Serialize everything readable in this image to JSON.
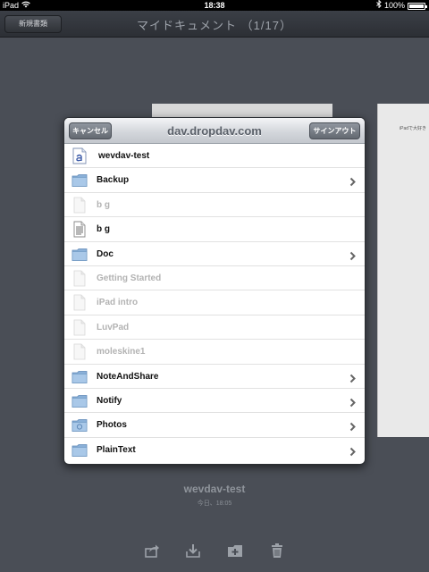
{
  "status_bar": {
    "carrier": "iPad",
    "time": "18:38",
    "battery": "100%"
  },
  "nav": {
    "new_document_label": "新規書類",
    "title": "マイドキュメント （1/17）"
  },
  "background_doc": {
    "preview_text": "iPadで大好き"
  },
  "popover": {
    "cancel_label": "キャンセル",
    "title": "dav.dropdav.com",
    "sign_out_label": "サインアウト",
    "items": [
      {
        "label": "wevdav-test",
        "icon": "app-document-icon",
        "enabled": true,
        "disclosure": false
      },
      {
        "label": "Backup",
        "icon": "folder-icon",
        "enabled": true,
        "disclosure": true
      },
      {
        "label": "b g",
        "icon": "blank-document-icon",
        "enabled": false,
        "disclosure": false
      },
      {
        "label": "b g",
        "icon": "text-document-icon",
        "enabled": true,
        "disclosure": false
      },
      {
        "label": "Doc",
        "icon": "folder-icon",
        "enabled": true,
        "disclosure": true
      },
      {
        "label": "Getting Started",
        "icon": "blank-document-icon",
        "enabled": false,
        "disclosure": false
      },
      {
        "label": "iPad intro",
        "icon": "blank-document-icon",
        "enabled": false,
        "disclosure": false
      },
      {
        "label": "LuvPad",
        "icon": "blank-document-icon",
        "enabled": false,
        "disclosure": false
      },
      {
        "label": "moleskine1",
        "icon": "blank-document-icon",
        "enabled": false,
        "disclosure": false
      },
      {
        "label": "NoteAndShare",
        "icon": "folder-icon",
        "enabled": true,
        "disclosure": true
      },
      {
        "label": "Notify",
        "icon": "folder-icon",
        "enabled": true,
        "disclosure": true
      },
      {
        "label": "Photos",
        "icon": "photos-folder-icon",
        "enabled": true,
        "disclosure": true
      },
      {
        "label": "PlainText",
        "icon": "folder-icon",
        "enabled": true,
        "disclosure": true
      }
    ]
  },
  "current_document": {
    "name": "wevdav-test",
    "date": "今日、18:05"
  },
  "toolbar": [
    "share-icon",
    "download-icon",
    "add-folder-icon",
    "trash-icon"
  ]
}
